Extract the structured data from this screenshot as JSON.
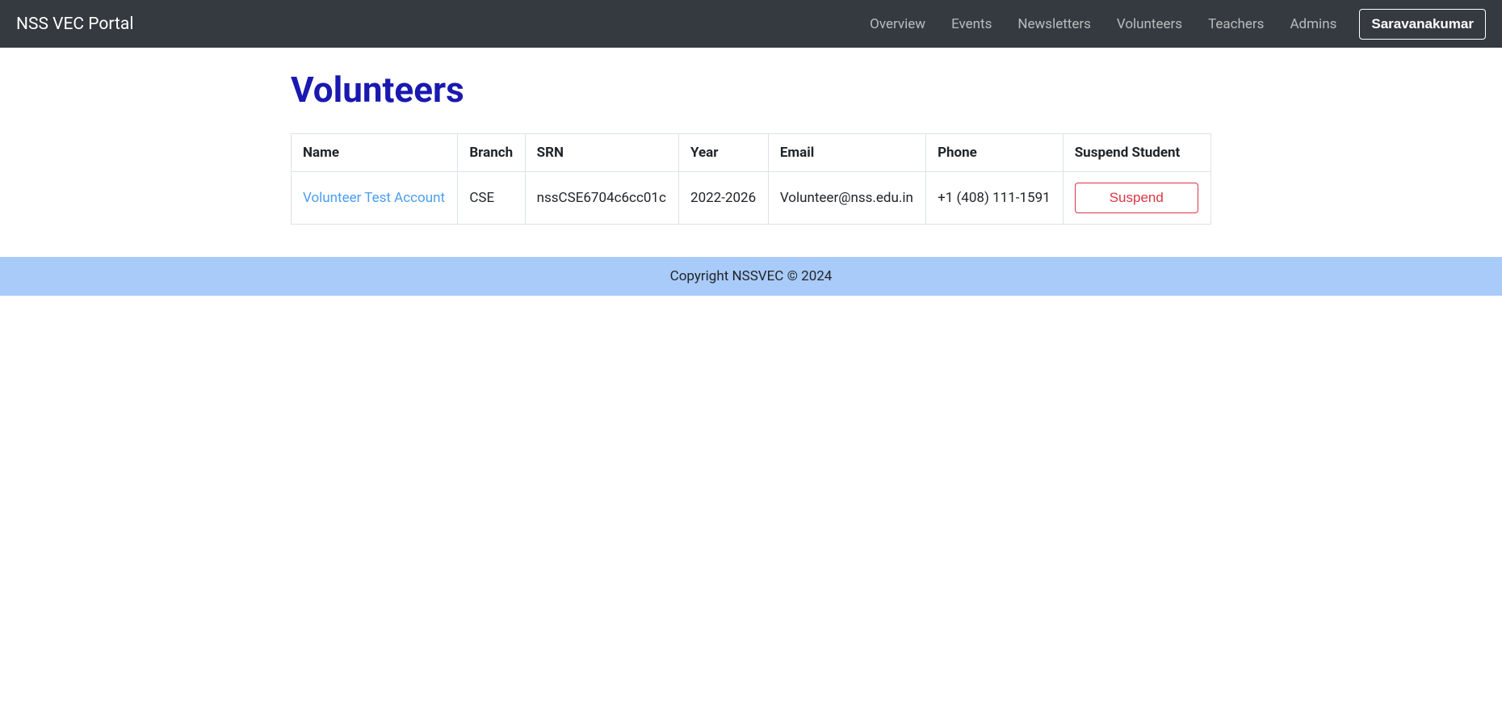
{
  "navbar": {
    "brand": "NSS VEC Portal",
    "links": [
      {
        "label": "Overview"
      },
      {
        "label": "Events"
      },
      {
        "label": "Newsletters"
      },
      {
        "label": "Volunteers"
      },
      {
        "label": "Teachers"
      },
      {
        "label": "Admins"
      }
    ],
    "user_button": "Saravanakumar"
  },
  "page": {
    "title": "Volunteers"
  },
  "table": {
    "headers": {
      "name": "Name",
      "branch": "Branch",
      "srn": "SRN",
      "year": "Year",
      "email": "Email",
      "phone": "Phone",
      "suspend": "Suspend Student"
    },
    "rows": [
      {
        "name": "Volunteer Test Account",
        "branch": "CSE",
        "srn": "nssCSE6704c6cc01c",
        "year": "2022-2026",
        "email": "Volunteer@nss.edu.in",
        "phone": "+1 (408) 111-1591",
        "suspend_label": "Suspend"
      }
    ]
  },
  "footer": {
    "text": "Copyright NSSVEC © 2024"
  }
}
